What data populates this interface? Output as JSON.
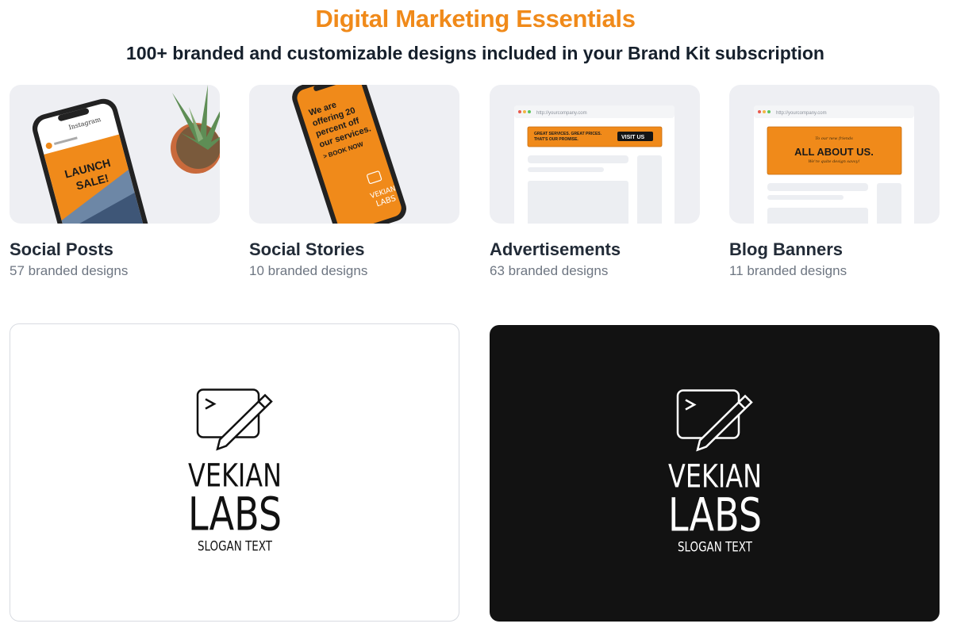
{
  "header": {
    "title": "Digital Marketing Essentials",
    "subtitle": "100+ branded and customizable designs included in your Brand Kit subscription"
  },
  "cards": [
    {
      "name": "Social Posts",
      "count": "57 branded designs",
      "thumb_text": [
        "LAUNCH",
        "SALE!"
      ]
    },
    {
      "name": "Social Stories",
      "count": "10 branded designs",
      "thumb_text": [
        "We are",
        "offering 20",
        "percent off",
        "our services.",
        "> BOOK NOW"
      ]
    },
    {
      "name": "Advertisements",
      "count": "63 branded designs",
      "url": "http://yourcompany.com",
      "ad_text": "GREAT SERVICES. GREAT PRICES.",
      "ad_text2": "THAT'S OUR PROMISE.",
      "ad_button": "VISIT US"
    },
    {
      "name": "Blog Banners",
      "count": "11 branded designs",
      "url": "http://yourcompany.com",
      "banner_kicker": "To our new friends",
      "banner_title": "ALL ABOUT US.",
      "banner_sub": "We're quite design savvy!"
    }
  ],
  "logo": {
    "line1": "VEKIAN",
    "line2": "LABS",
    "slogan": "SLOGAN TEXT"
  },
  "colors": {
    "accent": "#f08a1a",
    "dark_panel": "#121212"
  }
}
